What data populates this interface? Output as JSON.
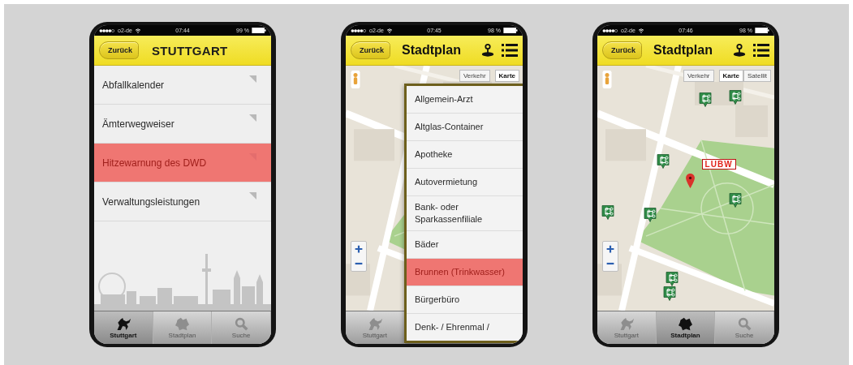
{
  "phones": [
    {
      "status": {
        "carrier": "o2-de",
        "time": "07:44",
        "battery": "99 %"
      },
      "header": {
        "back": "Zurück",
        "title": "STUTTGART",
        "kind": "logo"
      },
      "content": {
        "kind": "list",
        "items": [
          {
            "label": "Abfallkalender",
            "selected": false
          },
          {
            "label": "Ämterwegweiser",
            "selected": false
          },
          {
            "label": "Hitzewarnung des DWD",
            "selected": true
          },
          {
            "label": "Verwaltungsleistungen",
            "selected": false
          }
        ]
      },
      "tabs": [
        {
          "label": "Stuttgart",
          "selected": true
        },
        {
          "label": "Stadtplan",
          "selected": false
        },
        {
          "label": "Suche",
          "selected": false
        }
      ]
    },
    {
      "status": {
        "carrier": "o2-de",
        "time": "07:45",
        "battery": "98 %"
      },
      "header": {
        "back": "Zurück",
        "title": "Stadtplan",
        "kind": "map"
      },
      "content": {
        "kind": "map",
        "layers": [
          {
            "label": "Verkehr",
            "selected": false
          },
          {
            "label": "Karte",
            "selected": true
          }
        ],
        "menu": [
          {
            "label": "Allgemein-Arzt",
            "selected": false
          },
          {
            "label": "Altglas-Container",
            "selected": false
          },
          {
            "label": "Apotheke",
            "selected": false
          },
          {
            "label": "Autovermietung",
            "selected": false
          },
          {
            "label": "Bank- oder Sparkassenfiliale",
            "selected": false
          },
          {
            "label": "Bäder",
            "selected": false
          },
          {
            "label": "Brunnen (Trinkwasser)",
            "selected": true
          },
          {
            "label": "Bürgerbüro",
            "selected": false
          },
          {
            "label": "Denk- / Ehrenmal /",
            "selected": false
          }
        ]
      },
      "tabs": [
        {
          "label": "Stuttgart",
          "selected": false
        }
      ]
    },
    {
      "status": {
        "carrier": "o2-de",
        "time": "07:46",
        "battery": "98 %"
      },
      "header": {
        "back": "Zurück",
        "title": "Stadtplan",
        "kind": "map"
      },
      "content": {
        "kind": "map",
        "layers": [
          {
            "label": "Verkehr",
            "selected": false
          },
          {
            "label": "Karte",
            "selected": true
          },
          {
            "label": "Satellit",
            "selected": false
          }
        ],
        "poi_markers": true,
        "pin_label": "LUBW"
      },
      "tabs": [
        {
          "label": "Stuttgart",
          "selected": false
        },
        {
          "label": "Stadtplan",
          "selected": true
        },
        {
          "label": "Suche",
          "selected": false
        }
      ]
    }
  ]
}
